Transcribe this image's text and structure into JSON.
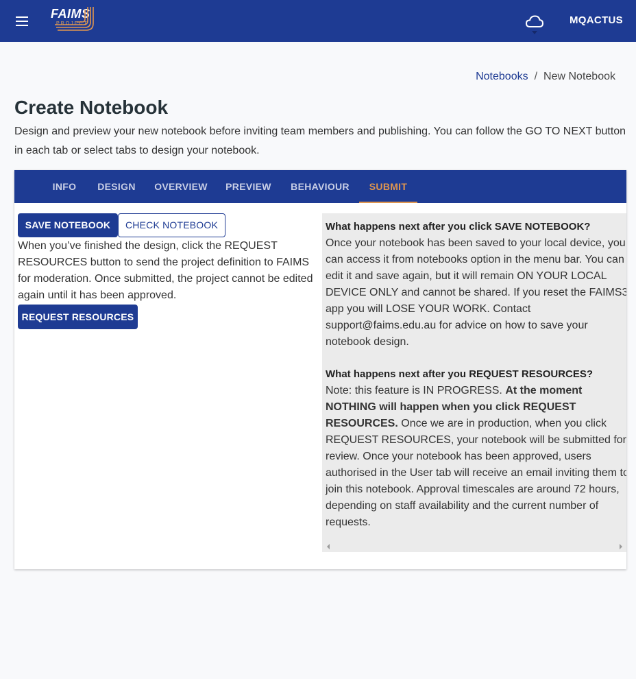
{
  "appbar": {
    "logo_text": "FAIMS",
    "logo_subtext": "PROJECT",
    "username": "MQACTUS"
  },
  "breadcrumb": {
    "items": [
      "Notebooks",
      "New Notebook"
    ],
    "separator": "/"
  },
  "page": {
    "title": "Create Notebook",
    "description": "Design and preview your new notebook before inviting team members and publishing. You can follow the GO TO NEXT button in each tab or select tabs to design your notebook."
  },
  "tabs": [
    {
      "label": "INFO"
    },
    {
      "label": "DESIGN"
    },
    {
      "label": "OVERVIEW"
    },
    {
      "label": "PREVIEW"
    },
    {
      "label": "BEHAVIOUR"
    },
    {
      "label": "SUBMIT",
      "active": true
    }
  ],
  "submit": {
    "save_label": "SAVE NOTEBOOK",
    "check_label": "CHECK NOTEBOOK",
    "request_label": "REQUEST RESOURCES",
    "instructions": "When you’ve finished the design, click the REQUEST RESOURCES button to send the project definition to FAIMS for moderation. Once submitted, the project cannot be edited again until it has been approved."
  },
  "info": {
    "save_heading": "What happens next after you click SAVE NOTEBOOK?",
    "save_text": "Once your notebook has been saved to your local device, you can access it from notebooks option in the menu bar. You can edit it and save again, but it will remain ON YOUR LOCAL DEVICE ONLY and cannot be shared. If you reset the FAIMS3 app you will LOSE YOUR WORK. Contact support@faims.edu.au for advice on how to save your notebook design.",
    "request_heading": "What happens next after you REQUEST RESOURCES?",
    "request_note": "Note: this feature is IN PROGRESS.",
    "request_bold": "At the moment NOTHING will happen when you click REQUEST RESOURCES.",
    "request_text": "Once we are in production, when you click REQUEST RESOURCES, your notebook will be submitted for review. Once your notebook has been approved, users authorised in the User tab will receive an email inviting them to join this notebook. Approval timescales are around 72 hours, depending on staff availability and the current number of requests."
  },
  "colors": {
    "primary": "#1e3b93",
    "accent": "#e0964f",
    "background": "#f8f9fb",
    "panel": "#ebebeb"
  },
  "icons": {
    "menu": "menu-icon",
    "sync": "cloud-icon"
  }
}
